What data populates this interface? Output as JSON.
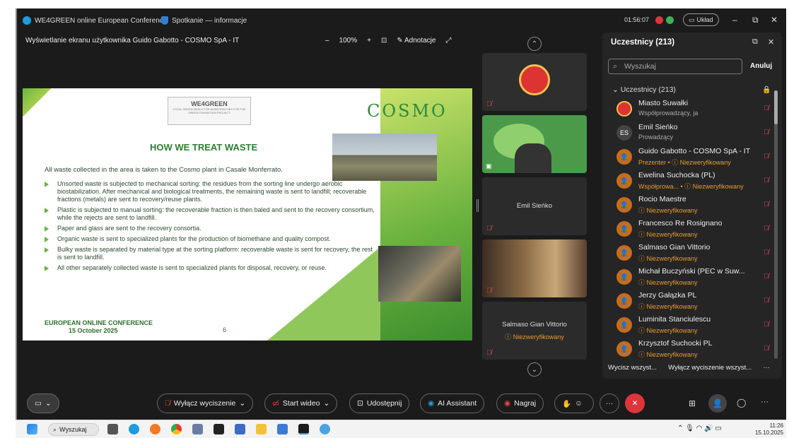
{
  "app": {
    "tab1": "WE4GREEN online European Conference",
    "tab2": "Spotkanie — informacje",
    "timer": "01:56:07",
    "layout_btn": "Układ",
    "minimize": "–",
    "restore": "⧉",
    "close": "✕"
  },
  "share": {
    "label": "Wyświetlanie ekranu użytkownika Guido Gabotto - COSMO SpA - IT",
    "zoom_out": "–",
    "zoom": "100%",
    "zoom_in": "+",
    "annotate": "Adnotacje"
  },
  "slide": {
    "badge_title": "WE4GREEN",
    "badge_sub": "LOCAL GREEN DEALS FOR MUNICIPALITIES FOR THE GREEN TRANSITION PROJECT",
    "logo": "COSMO",
    "title": "HOW WE TREAT WASTE",
    "intro": "All waste collected in the area is taken to the Cosmo plant in Casale Monferrato.",
    "bullets": [
      "Unsorted waste is subjected to mechanical sorting: the residues from the sorting line undergo aerobic biostabilization. After mechanical and biological treatments, the remaining waste is sent to landfill; recoverable fractions (metals) are sent to recovery/reuse plants.",
      "Plastic is subjected to manual sorting: the recoverable fraction is then baled and sent to the recovery consortium, while the rejects are sent to landfill.",
      "Paper and glass are sent to the recovery consortia.",
      "Organic waste is sent to specialized plants for the production of biomethane and quality compost.",
      "Bulky waste is separated by material type at the sorting platform: recoverable waste is sent for recovery, the rest is sent to landfill.",
      "All other separately collected waste is sent to specialized plants for disposal, recovery, or reuse."
    ],
    "conf1": "EUROPEAN ONLINE CONFERENCE",
    "conf2": "15 October 2025",
    "page": "6"
  },
  "tiles": {
    "t3_name": "Emil Sieńko",
    "t5_name": "Salmaso Gian Vittorio",
    "t5_status": "Niezweryfikowany"
  },
  "panel": {
    "title": "Uczestnicy (213)",
    "search_placeholder": "Wyszukaj",
    "cancel": "Anuluj",
    "group": "Uczestnicy (213)",
    "people": [
      {
        "name": "Miasto Suwałki",
        "sub": "Współprowadzący, ja",
        "initials": "",
        "warn": false
      },
      {
        "name": "Emil Sieńko",
        "sub": "Prowadzący",
        "initials": "ES",
        "warn": false
      },
      {
        "name": "Guido Gabotto - COSMO SpA - IT",
        "sub": "Prezenter • ⓘ Niezweryfikowany",
        "initials": "",
        "warn": true
      },
      {
        "name": "Ewelina Suchocka (PL)",
        "sub": "Współprowa... • ⓘ Niezweryfikowany",
        "initials": "",
        "warn": true
      },
      {
        "name": "Rocio Maestre",
        "sub": "ⓘ Niezweryfikowany",
        "initials": "",
        "warn": true
      },
      {
        "name": "Francesco Re Rosignano",
        "sub": "ⓘ Niezweryfikowany",
        "initials": "",
        "warn": true
      },
      {
        "name": "Salmaso Gian Vittorio",
        "sub": "ⓘ Niezweryfikowany",
        "initials": "",
        "warn": true
      },
      {
        "name": "Michał Buczyński (PEC w Suw...",
        "sub": "ⓘ Niezweryfikowany",
        "initials": "",
        "warn": true
      },
      {
        "name": "Jerzy Gałązka PL",
        "sub": "ⓘ Niezweryfikowany",
        "initials": "",
        "warn": true
      },
      {
        "name": "Luminita Stanciulescu",
        "sub": "ⓘ Niezweryfikowany",
        "initials": "",
        "warn": true
      },
      {
        "name": "Krzysztof Suchocki PL",
        "sub": "ⓘ Niezweryfikowany",
        "initials": "",
        "warn": true
      }
    ],
    "mute_all": "Wycisz wszyst...",
    "unmute_all": "Wyłącz wyciszenie wszyst...",
    "more": "···"
  },
  "toolbar": {
    "unmute": "Wyłącz wyciszenie",
    "video": "Start wideo",
    "share": "Udostępnij",
    "ai": "AI Assistant",
    "record": "Nagraj",
    "more": "···",
    "end": "✕"
  },
  "taskbar": {
    "search": "Wyszukaj",
    "time": "11:26",
    "date": "15.10.2025"
  },
  "colors": {
    "accent_green": "#6cb33f",
    "warn": "#e89a2c",
    "mute_red": "#e04a4a",
    "end_red": "#e0343c"
  }
}
